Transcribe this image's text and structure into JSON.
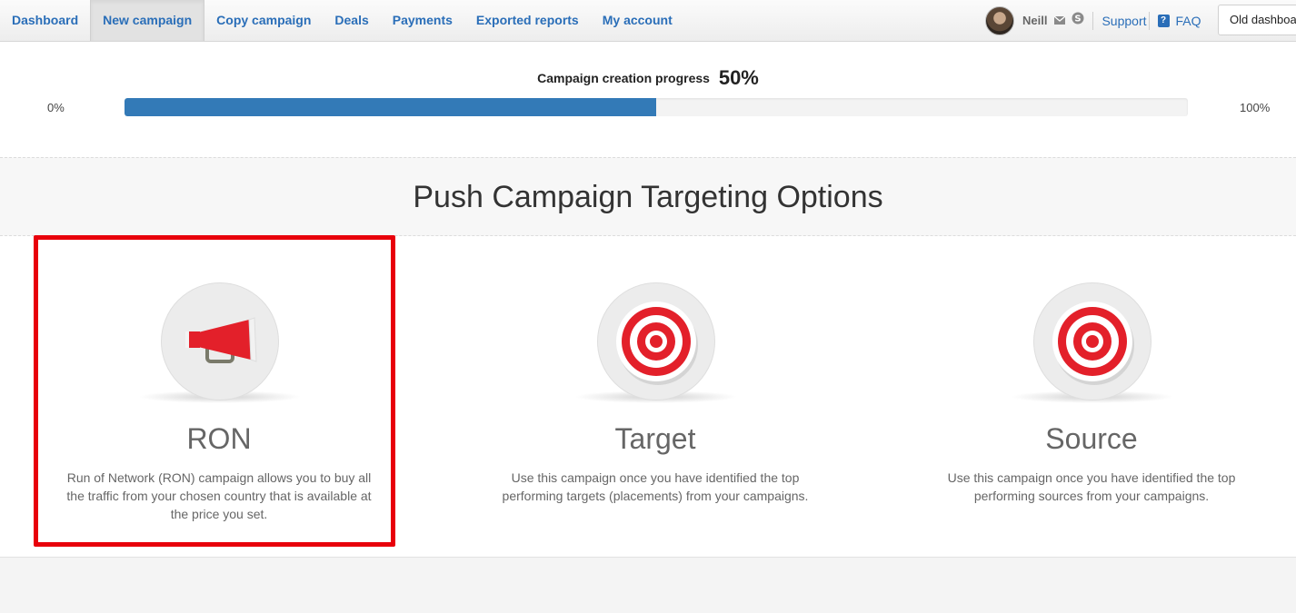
{
  "nav": {
    "items": [
      {
        "label": "Dashboard",
        "active": false
      },
      {
        "label": "New campaign",
        "active": true
      },
      {
        "label": "Copy campaign",
        "active": false
      },
      {
        "label": "Deals",
        "active": false
      },
      {
        "label": "Payments",
        "active": false
      },
      {
        "label": "Exported reports",
        "active": false
      },
      {
        "label": "My account",
        "active": false
      }
    ],
    "user_name": "Neill",
    "support_label": "Support",
    "faq_label": "FAQ",
    "faq_icon_text": "?",
    "old_dashboard_label": "Old dashboard"
  },
  "progress": {
    "title": "Campaign creation progress",
    "value_label": "50%",
    "value": 0.5,
    "min_label": "0%",
    "max_label": "100%"
  },
  "page_title": "Push Campaign Targeting Options",
  "options": [
    {
      "title": "RON",
      "icon": "megaphone-icon",
      "description": "Run of Network (RON) campaign allows you to buy all the traffic from your chosen country that is available at the price you set.",
      "highlighted": true
    },
    {
      "title": "Target",
      "icon": "target-icon",
      "description": "Use this campaign once you have identified the top performing targets (placements) from your campaigns.",
      "highlighted": false
    },
    {
      "title": "Source",
      "icon": "target-icon",
      "description": "Use this campaign once you have identified the top performing sources from your campaigns.",
      "highlighted": false
    }
  ],
  "colors": {
    "link": "#2a6eb8",
    "progress_fill": "#337ab7",
    "highlight_border": "#e8000b",
    "icon_red": "#e3202a"
  }
}
